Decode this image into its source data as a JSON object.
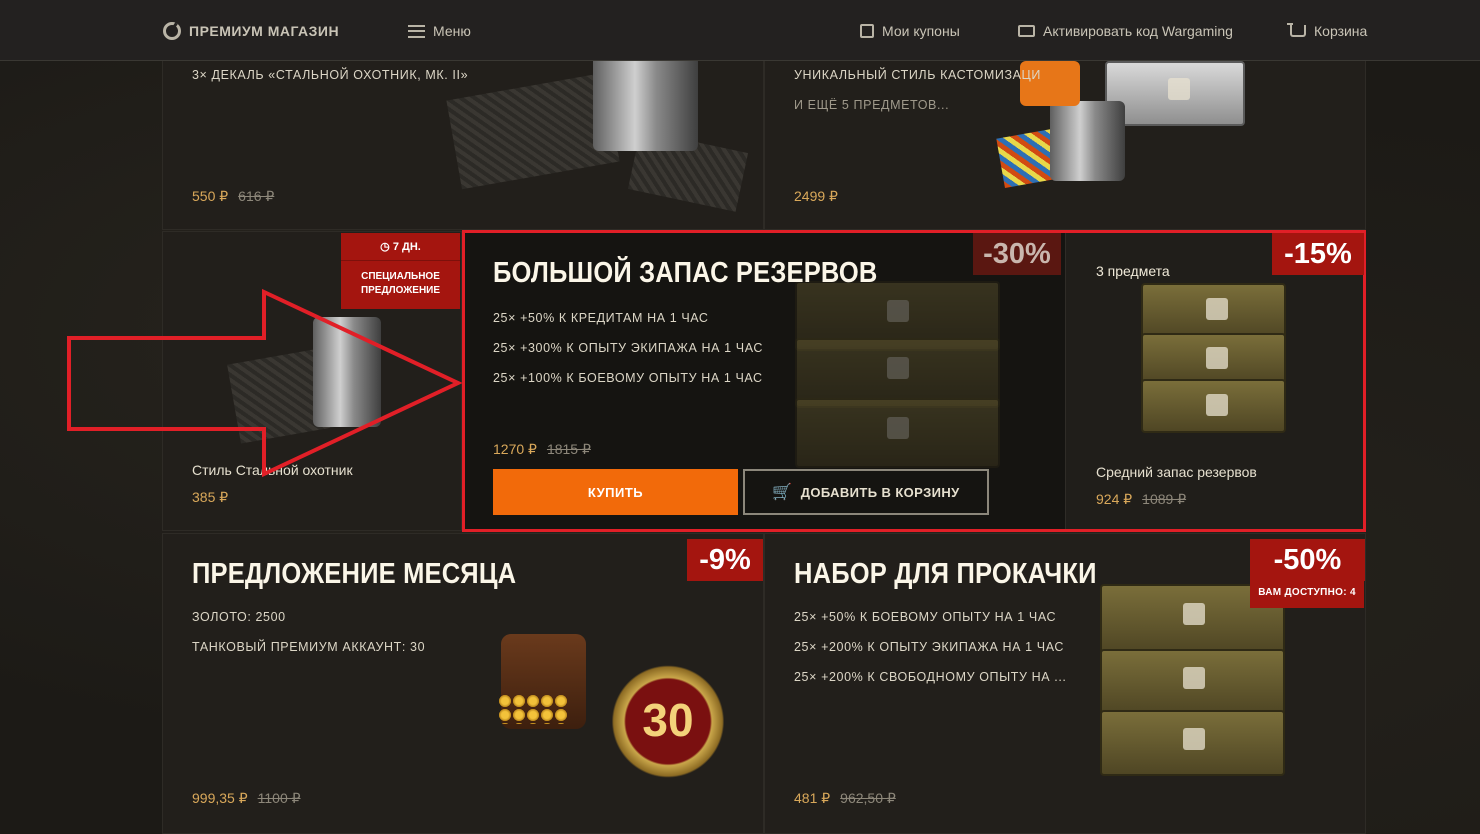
{
  "header": {
    "logo_label": "ПРЕМИУМ МАГАЗИН",
    "menu_label": "Меню",
    "coupons_label": "Мои купоны",
    "activate_label": "Активировать код Wargaming",
    "cart_label": "Корзина"
  },
  "card_steel": {
    "line1": "3× ДЕКАЛЬ «СТАЛЬНОЙ ОХОТНИК, МК. II»",
    "price": "550 ₽",
    "old_price": "616 ₽"
  },
  "card_fest": {
    "line1": "УНИКАЛЬНЫЙ СТИЛЬ КАСТОМИЗАЦИ",
    "line2": "И ЕЩЁ 5 ПРЕДМЕТОВ...",
    "price": "2499 ₽"
  },
  "card_style": {
    "timer": "7 ДН.",
    "special_line1": "СПЕЦИАЛЬНОЕ",
    "special_line2": "ПРЕДЛОЖЕНИЕ",
    "name": "Стиль Стальной охотник",
    "price": "385 ₽"
  },
  "featured": {
    "title": "БОЛЬШОЙ ЗАПАС РЕЗЕРВОВ",
    "discount": "-30%",
    "items": [
      "25× +50% К КРЕДИТАМ НА 1 ЧАС",
      "25× +300% К ОПЫТУ ЭКИПАЖА НА 1 ЧАС",
      "25× +100% К БОЕВОМУ ОПЫТУ НА 1 ЧАС"
    ],
    "price": "1270 ₽",
    "old_price": "1815 ₽",
    "buy_label": "КУПИТЬ",
    "add_to_cart_label": "ДОБАВИТЬ В КОРЗИНУ"
  },
  "card_medium": {
    "count": "3 предмета",
    "discount": "-15%",
    "name": "Средний запас резервов",
    "price": "924 ₽",
    "old_price": "1089 ₽"
  },
  "card_month": {
    "title": "ПРЕДЛОЖЕНИЕ МЕСЯЦА",
    "discount": "-9%",
    "line1": "ЗОЛОТО: 2500",
    "line2": "ТАНКОВЫЙ ПРЕМИУМ АККАУНТ: 30",
    "medal_number": "30",
    "price": "999,35 ₽",
    "old_price": "1100 ₽"
  },
  "card_level": {
    "title": "НАБОР ДЛЯ ПРОКАЧКИ",
    "discount": "-50%",
    "available": "ВАМ ДОСТУПНО: 4",
    "items": [
      "25× +50% К БОЕВОМУ ОПЫТУ НА 1 ЧАС",
      "25× +200% К ОПЫТУ ЭКИПАЖА НА 1 ЧАС",
      "25× +200% К СВОБОДНОМУ ОПЫТУ НА ..."
    ],
    "price": "481 ₽",
    "old_price": "962,50 ₽"
  },
  "colors": {
    "accent_orange": "#f26a0a",
    "discount_red": "#a4150f",
    "highlight_red": "#e11f27",
    "price_gold": "#d9a85a"
  }
}
